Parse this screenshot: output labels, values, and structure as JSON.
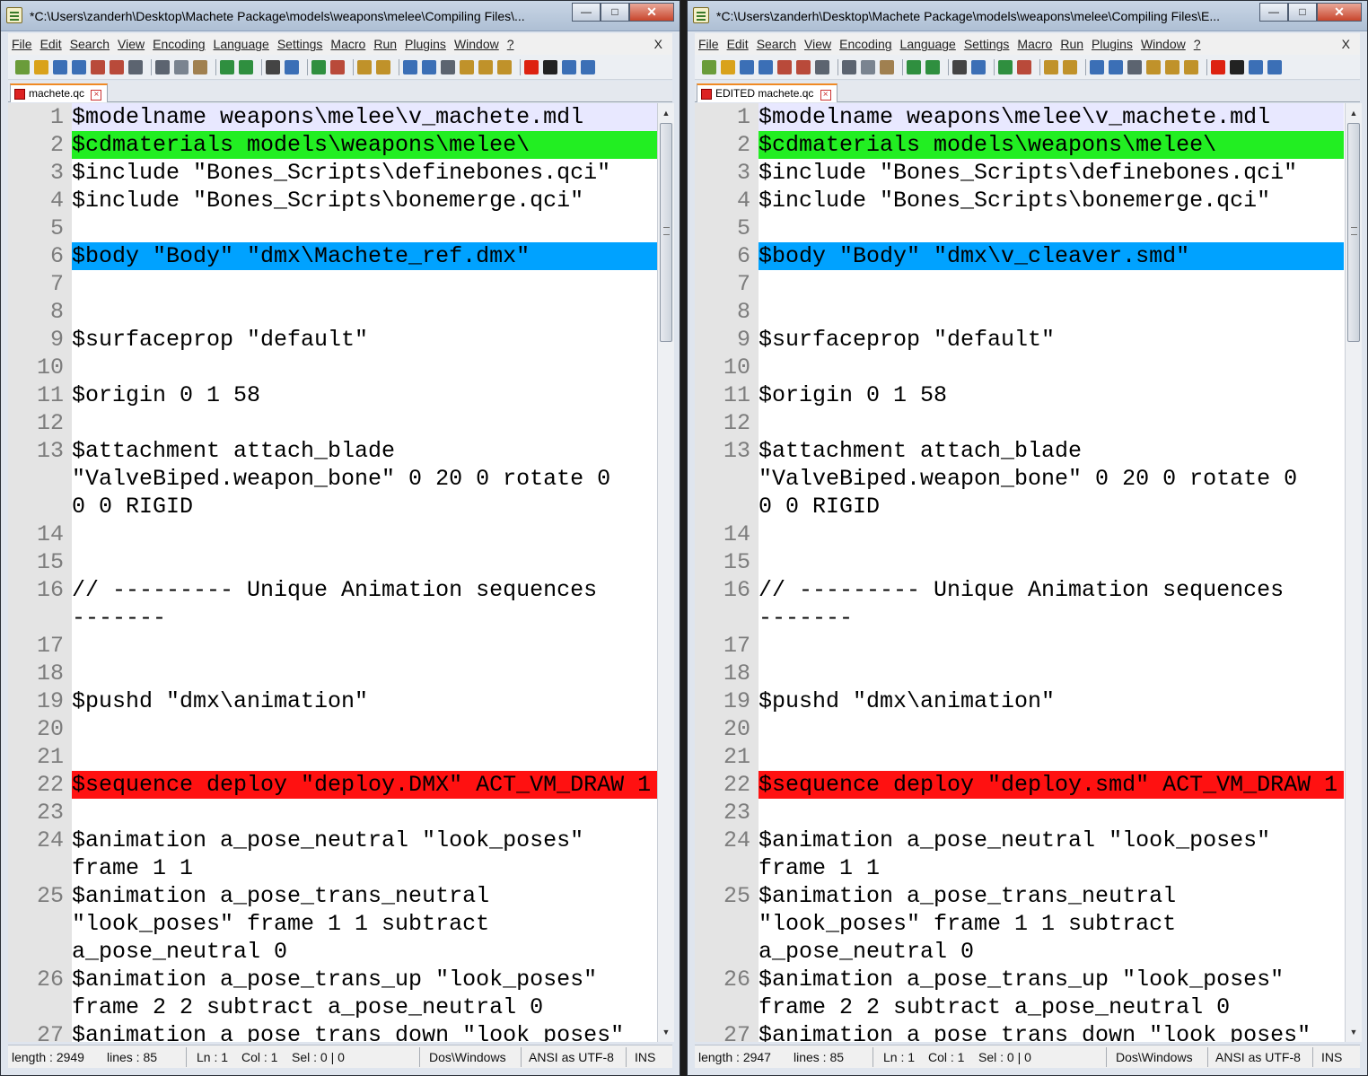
{
  "colors": {
    "highlight_lavender": "#e8e8ff",
    "highlight_green": "#22ee22",
    "highlight_blue": "#00a2ff",
    "highlight_red": "#ff1111",
    "tab_accent": "#f08a24"
  },
  "menu": [
    "File",
    "Edit",
    "Search",
    "View",
    "Encoding",
    "Language",
    "Settings",
    "Macro",
    "Run",
    "Plugins",
    "Window",
    "?"
  ],
  "menu_close": "X",
  "toolbar_icons": [
    "new-icon",
    "open-icon",
    "save-icon",
    "save-all-icon",
    "close-icon",
    "close-all-icon",
    "print-icon",
    "cut-icon",
    "copy-icon",
    "paste-icon",
    "undo-icon",
    "redo-icon",
    "find-icon",
    "replace-icon",
    "zoom-in-icon",
    "zoom-out-icon",
    "sync-vertical-icon",
    "sync-horizontal-icon",
    "word-wrap-icon",
    "show-all-chars-icon",
    "indent-guide-icon",
    "doc-map-icon",
    "function-list-icon",
    "folder-as-workspace-icon",
    "record-macro-icon",
    "stop-macro-icon",
    "play-macro-icon",
    "run-macro-multiple-icon"
  ],
  "windows": [
    {
      "title": "*C:\\Users\\zanderh\\Desktop\\Machete Package\\models\\weapons\\melee\\Compiling Files\\...",
      "tab": "machete.qc",
      "lines": [
        {
          "n": "1",
          "t": "$modelname weapons\\melee\\v_machete.mdl",
          "hl": "lav"
        },
        {
          "n": "2",
          "t": "$cdmaterials models\\weapons\\melee\\",
          "hl": "green"
        },
        {
          "n": "3",
          "t": "$include \"Bones_Scripts\\definebones.qci\"",
          "hl": ""
        },
        {
          "n": "4",
          "t": "$include \"Bones_Scripts\\bonemerge.qci\"",
          "hl": ""
        },
        {
          "n": "5",
          "t": "",
          "hl": ""
        },
        {
          "n": "6",
          "t": "$body \"Body\" \"dmx\\Machete_ref.dmx\"",
          "hl": "blue"
        },
        {
          "n": "7",
          "t": "",
          "hl": ""
        },
        {
          "n": "8",
          "t": "",
          "hl": ""
        },
        {
          "n": "9",
          "t": "$surfaceprop \"default\"",
          "hl": ""
        },
        {
          "n": "10",
          "t": "",
          "hl": ""
        },
        {
          "n": "11",
          "t": "$origin 0 1 58",
          "hl": ""
        },
        {
          "n": "12",
          "t": "",
          "hl": ""
        },
        {
          "n": "13",
          "t": "$attachment attach_blade",
          "hl": ""
        },
        {
          "n": "",
          "t": "\"ValveBiped.weapon_bone\" 0 20 0 rotate 0",
          "hl": ""
        },
        {
          "n": "",
          "t": "0 0 RIGID",
          "hl": ""
        },
        {
          "n": "14",
          "t": "",
          "hl": ""
        },
        {
          "n": "15",
          "t": "",
          "hl": ""
        },
        {
          "n": "16",
          "t": "// --------- Unique Animation sequences",
          "hl": ""
        },
        {
          "n": "",
          "t": "-------",
          "hl": ""
        },
        {
          "n": "17",
          "t": "",
          "hl": ""
        },
        {
          "n": "18",
          "t": "",
          "hl": ""
        },
        {
          "n": "19",
          "t": "$pushd \"dmx\\animation\"",
          "hl": ""
        },
        {
          "n": "20",
          "t": "",
          "hl": ""
        },
        {
          "n": "21",
          "t": "",
          "hl": ""
        },
        {
          "n": "22",
          "t": "$sequence deploy \"deploy.DMX\" ACT_VM_DRAW 1",
          "hl": "red"
        },
        {
          "n": "23",
          "t": "",
          "hl": ""
        },
        {
          "n": "24",
          "t": "$animation a_pose_neutral \"look_poses\"",
          "hl": ""
        },
        {
          "n": "",
          "t": "frame 1 1",
          "hl": ""
        },
        {
          "n": "25",
          "t": "$animation a_pose_trans_neutral",
          "hl": ""
        },
        {
          "n": "",
          "t": "\"look_poses\" frame 1 1 subtract",
          "hl": ""
        },
        {
          "n": "",
          "t": "a_pose_neutral 0",
          "hl": ""
        },
        {
          "n": "26",
          "t": "$animation a_pose_trans_up \"look_poses\"",
          "hl": ""
        },
        {
          "n": "",
          "t": "frame 2 2 subtract a_pose_neutral 0",
          "hl": ""
        },
        {
          "n": "27",
          "t": "$animation a_pose_trans_down \"look_poses\"",
          "hl": ""
        }
      ],
      "status": {
        "length": "length : 2949",
        "lines": "lines : 85",
        "ln": "Ln : 1",
        "col": "Col : 1",
        "sel": "Sel : 0 | 0",
        "eol": "Dos\\Windows",
        "enc": "ANSI as UTF-8",
        "ins": "INS"
      }
    },
    {
      "title": "*C:\\Users\\zanderh\\Desktop\\Machete Package\\models\\weapons\\melee\\Compiling Files\\E...",
      "tab": "EDITED machete.qc",
      "lines": [
        {
          "n": "1",
          "t": "$modelname weapons\\melee\\v_machete.mdl",
          "hl": "lav"
        },
        {
          "n": "2",
          "t": "$cdmaterials models\\weapons\\melee\\",
          "hl": "green"
        },
        {
          "n": "3",
          "t": "$include \"Bones_Scripts\\definebones.qci\"",
          "hl": ""
        },
        {
          "n": "4",
          "t": "$include \"Bones_Scripts\\bonemerge.qci\"",
          "hl": ""
        },
        {
          "n": "5",
          "t": "",
          "hl": ""
        },
        {
          "n": "6",
          "t": "$body \"Body\" \"dmx\\v_cleaver.smd\"",
          "hl": "blue"
        },
        {
          "n": "7",
          "t": "",
          "hl": ""
        },
        {
          "n": "8",
          "t": "",
          "hl": ""
        },
        {
          "n": "9",
          "t": "$surfaceprop \"default\"",
          "hl": ""
        },
        {
          "n": "10",
          "t": "",
          "hl": ""
        },
        {
          "n": "11",
          "t": "$origin 0 1 58",
          "hl": ""
        },
        {
          "n": "12",
          "t": "",
          "hl": ""
        },
        {
          "n": "13",
          "t": "$attachment attach_blade",
          "hl": ""
        },
        {
          "n": "",
          "t": "\"ValveBiped.weapon_bone\" 0 20 0 rotate 0",
          "hl": ""
        },
        {
          "n": "",
          "t": "0 0 RIGID",
          "hl": ""
        },
        {
          "n": "14",
          "t": "",
          "hl": ""
        },
        {
          "n": "15",
          "t": "",
          "hl": ""
        },
        {
          "n": "16",
          "t": "// --------- Unique Animation sequences",
          "hl": ""
        },
        {
          "n": "",
          "t": "-------",
          "hl": ""
        },
        {
          "n": "17",
          "t": "",
          "hl": ""
        },
        {
          "n": "18",
          "t": "",
          "hl": ""
        },
        {
          "n": "19",
          "t": "$pushd \"dmx\\animation\"",
          "hl": ""
        },
        {
          "n": "20",
          "t": "",
          "hl": ""
        },
        {
          "n": "21",
          "t": "",
          "hl": ""
        },
        {
          "n": "22",
          "t": "$sequence deploy \"deploy.smd\" ACT_VM_DRAW 1",
          "hl": "red"
        },
        {
          "n": "23",
          "t": "",
          "hl": ""
        },
        {
          "n": "24",
          "t": "$animation a_pose_neutral \"look_poses\"",
          "hl": ""
        },
        {
          "n": "",
          "t": "frame 1 1",
          "hl": ""
        },
        {
          "n": "25",
          "t": "$animation a_pose_trans_neutral",
          "hl": ""
        },
        {
          "n": "",
          "t": "\"look_poses\" frame 1 1 subtract",
          "hl": ""
        },
        {
          "n": "",
          "t": "a_pose_neutral 0",
          "hl": ""
        },
        {
          "n": "26",
          "t": "$animation a_pose_trans_up \"look_poses\"",
          "hl": ""
        },
        {
          "n": "",
          "t": "frame 2 2 subtract a_pose_neutral 0",
          "hl": ""
        },
        {
          "n": "27",
          "t": "$animation a_pose_trans_down \"look_poses\"",
          "hl": ""
        }
      ],
      "status": {
        "length": "length : 2947",
        "lines": "lines : 85",
        "ln": "Ln : 1",
        "col": "Col : 1",
        "sel": "Sel : 0 | 0",
        "eol": "Dos\\Windows",
        "enc": "ANSI as UTF-8",
        "ins": "INS"
      }
    }
  ]
}
